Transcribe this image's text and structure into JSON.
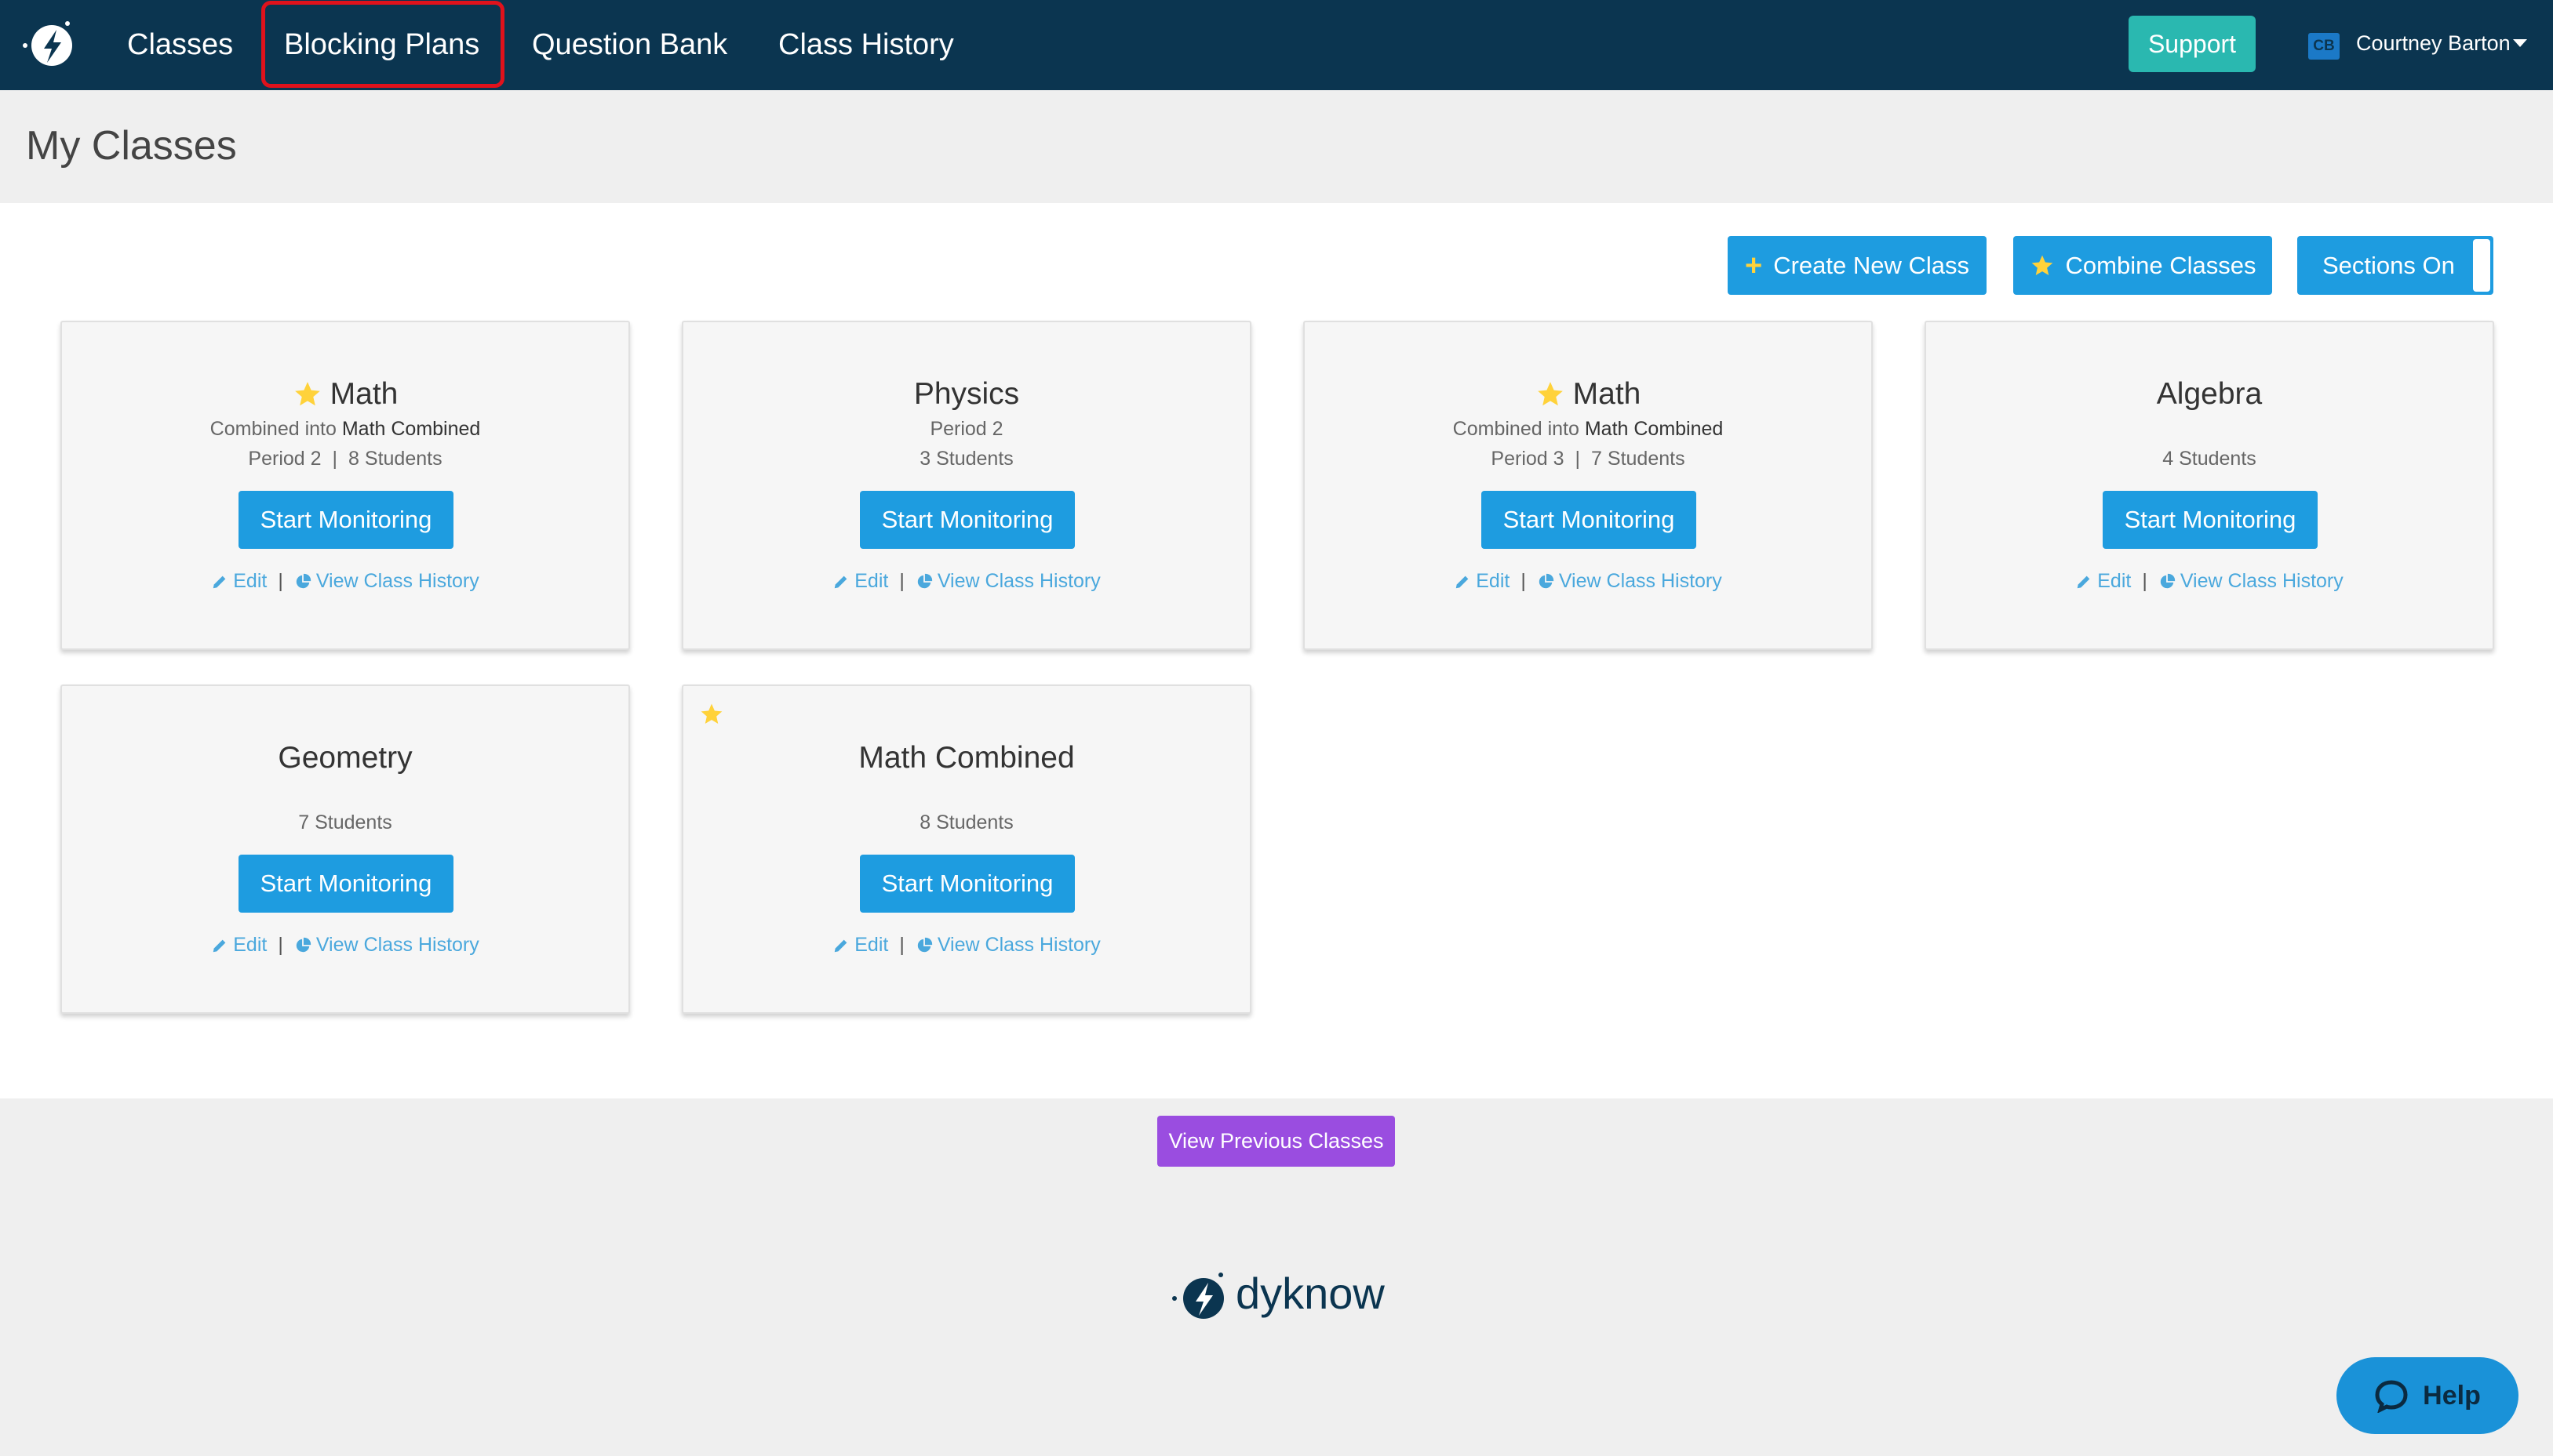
{
  "nav": {
    "items": [
      {
        "label": "Classes"
      },
      {
        "label": "Blocking Plans"
      },
      {
        "label": "Question Bank"
      },
      {
        "label": "Class History"
      }
    ],
    "support_label": "Support",
    "user_initials": "CB",
    "user_name": "Courtney Barton"
  },
  "page": {
    "title": "My Classes"
  },
  "toolbar": {
    "create_label": "Create New Class",
    "combine_label": "Combine Classes",
    "sections_label": "Sections On"
  },
  "cards": [
    {
      "title": "Math",
      "combined_prefix": "Combined into",
      "combined_name": "Math Combined",
      "period": "Period 2",
      "students": "8 Students",
      "button": "Start Monitoring",
      "edit": "Edit",
      "history": "View Class History"
    },
    {
      "title": "Physics",
      "period": "Period 2",
      "students": "3 Students",
      "button": "Start Monitoring",
      "edit": "Edit",
      "history": "View Class History"
    },
    {
      "title": "Math",
      "combined_prefix": "Combined into",
      "combined_name": "Math Combined",
      "period": "Period 3",
      "students": "7 Students",
      "button": "Start Monitoring",
      "edit": "Edit",
      "history": "View Class History"
    },
    {
      "title": "Algebra",
      "students": "4 Students",
      "button": "Start Monitoring",
      "edit": "Edit",
      "history": "View Class History"
    },
    {
      "title": "Geometry",
      "students": "7 Students",
      "button": "Start Monitoring",
      "edit": "Edit",
      "history": "View Class History"
    },
    {
      "title": "Math Combined",
      "students": "8 Students",
      "button": "Start Monitoring",
      "edit": "Edit",
      "history": "View Class History"
    }
  ],
  "footer": {
    "previous_label": "View Previous Classes",
    "brand": "dyknow",
    "help_label": "Help"
  },
  "colors": {
    "nav_bg": "#0b3550",
    "primary": "#1e9ce0",
    "support": "#2ab8b0",
    "previous": "#9a4de0",
    "star": "#ffd23a",
    "highlight": "#e0121c"
  }
}
